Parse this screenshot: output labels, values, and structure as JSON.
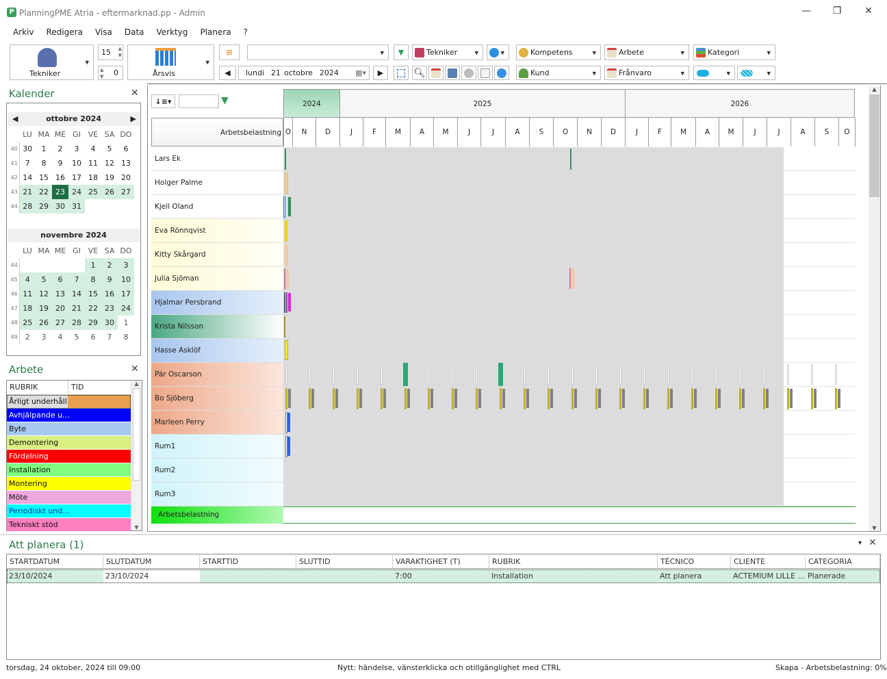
{
  "window": {
    "title": "PlanningPME Atria - eftermarknad.pp - Admin",
    "logo": "P"
  },
  "menu": [
    "Arkiv",
    "Redigera",
    "Visa",
    "Data",
    "Verktyg",
    "Planera",
    "?"
  ],
  "toolbar": {
    "view_label": "Tekniker",
    "spin1": "15",
    "spin2": "0",
    "period_label": "Årsvis",
    "search_value": "",
    "date": {
      "day": "lundi",
      "num": "21",
      "month": "octobre",
      "year": "2024"
    },
    "filters": {
      "tekniker": "Tekniker",
      "kompetens": "Kompetens",
      "arbete": "Arbete",
      "kategori": "Kategori",
      "kund": "Kund",
      "franvaro": "Frånvaro"
    }
  },
  "calendar": {
    "title": "Kalender",
    "weekdays": [
      "LU",
      "MA",
      "ME",
      "GI",
      "VE",
      "SA",
      "DO"
    ],
    "months": [
      {
        "name": "ottobre 2024",
        "weeks": [
          [
            "40",
            "30",
            "1",
            "2",
            "3",
            "4",
            "5",
            "6"
          ],
          [
            "41",
            "7",
            "8",
            "9",
            "10",
            "11",
            "12",
            "13"
          ],
          [
            "42",
            "14",
            "15",
            "16",
            "17",
            "18",
            "19",
            "20"
          ],
          [
            "43",
            "21",
            "22",
            "23",
            "24",
            "25",
            "26",
            "27"
          ],
          [
            "44",
            "28",
            "29",
            "30",
            "31",
            "",
            "",
            ""
          ]
        ]
      },
      {
        "name": "novembre 2024",
        "weeks": [
          [
            "44",
            "",
            "",
            "",
            "",
            "1",
            "2",
            "3"
          ],
          [
            "45",
            "4",
            "5",
            "6",
            "7",
            "8",
            "9",
            "10"
          ],
          [
            "46",
            "11",
            "12",
            "13",
            "14",
            "15",
            "16",
            "17"
          ],
          [
            "47",
            "18",
            "19",
            "20",
            "21",
            "22",
            "23",
            "24"
          ],
          [
            "48",
            "25",
            "26",
            "27",
            "28",
            "29",
            "30",
            "1"
          ],
          [
            "49",
            "2",
            "3",
            "4",
            "5",
            "6",
            "7",
            "8"
          ]
        ]
      }
    ],
    "selected": "23"
  },
  "arbete": {
    "title": "Arbete",
    "col_rubrik": "RUBRIK",
    "col_tid": "TID",
    "items": [
      {
        "label": "Årligt underhåll",
        "color": "#e8a050"
      },
      {
        "label": "Avhjälpande u...",
        "color": "#0000ff"
      },
      {
        "label": "Byte",
        "color": "#a8c8f0"
      },
      {
        "label": "Demontering",
        "color": "#d8f080"
      },
      {
        "label": "Fördelning",
        "color": "#ff0000"
      },
      {
        "label": "Installation",
        "color": "#80ff80"
      },
      {
        "label": "Montering",
        "color": "#ffff00"
      },
      {
        "label": "Möte",
        "color": "#f0a8e0"
      },
      {
        "label": "Periodiskt und...",
        "color": "#00ffff"
      },
      {
        "label": "Tekniskt stöd",
        "color": "#ff80c0"
      }
    ]
  },
  "gantt": {
    "header_label": "Arbetsbelastning",
    "years": [
      "2024",
      "2025",
      "2026"
    ],
    "months": [
      "O",
      "N",
      "D",
      "J",
      "F",
      "M",
      "A",
      "M",
      "J",
      "J",
      "A",
      "S",
      "O",
      "N",
      "D",
      "J",
      "F",
      "M",
      "A",
      "M",
      "J",
      "J",
      "A",
      "S",
      "O"
    ],
    "resources": [
      "Lars Ek",
      "Holger Palme",
      "Kjell Oland",
      "Eva Rönnqvist",
      "Kitty Skårgard",
      "Julia Sjöman",
      "Hjalmar Persbrand",
      "Krista Nilsson",
      "Hasse Asklöf",
      "Pär Oscarson",
      "Bo Sjöberg",
      "Marleen Perry",
      "Rum1",
      "Rum2",
      "Rum3"
    ],
    "footer_label": "Arbetsbelastning"
  },
  "att_planera": {
    "title": "Att planera (1)",
    "columns": [
      "STARTDATUM",
      "SLUTDATUM",
      "STARTTID",
      "SLUTTID",
      "VARAKTIGHET (T)",
      "RUBRIK",
      "TÉCNICO",
      "CLIENTE",
      "CATEGORIA"
    ],
    "rows": [
      [
        "23/10/2024",
        "23/10/2024",
        "",
        "",
        "7:00",
        "Installation",
        "Att planera",
        "ACTEMIUM LILLE ...",
        "Planerade"
      ]
    ]
  },
  "status": {
    "left": "torsdag, 24 oktober, 2024 till 09:00",
    "center": "Nytt: händelse, vänsterklicka och otillgänglighet med CTRL",
    "right": "Skapa - Arbetsbelastning: 0%"
  }
}
